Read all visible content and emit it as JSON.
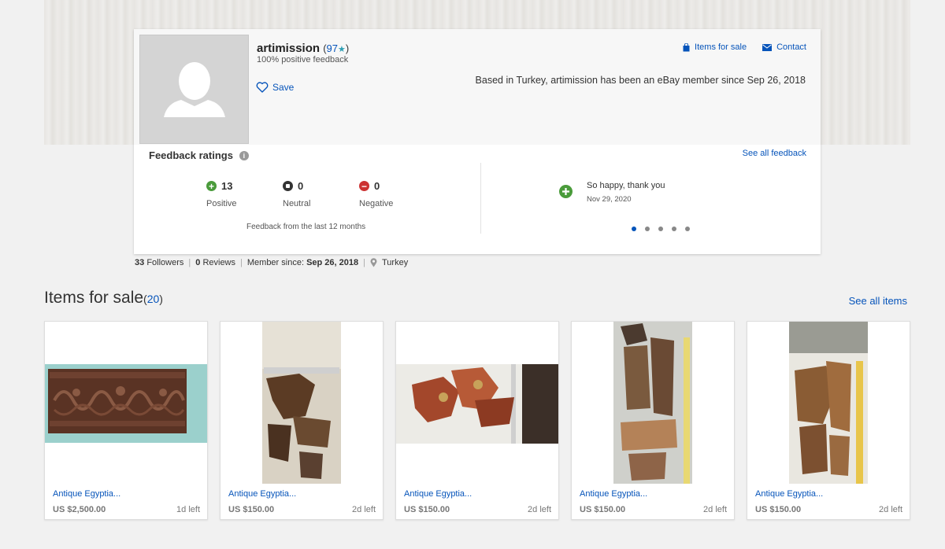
{
  "seller": {
    "username": "artimission",
    "score": "97",
    "positive_feedback": "100% positive feedback",
    "save_label": "Save",
    "based_text": "Based in Turkey, artimission has been an eBay member since Sep 26, 2018"
  },
  "top_links": {
    "items_for_sale": "Items for sale",
    "contact": "Contact"
  },
  "feedback": {
    "title": "Feedback ratings",
    "see_all": "See all feedback",
    "positive": {
      "count": "13",
      "label": "Positive"
    },
    "neutral": {
      "count": "0",
      "label": "Neutral"
    },
    "negative": {
      "count": "0",
      "label": "Negative"
    },
    "period": "Feedback from the last 12 months",
    "comment": "So happy, thank you",
    "comment_date": "Nov 29, 2020",
    "carousel_dots": 5,
    "carousel_active": 0
  },
  "stats": {
    "followers_count": "33",
    "followers_label": "Followers",
    "reviews_count": "0",
    "reviews_label": "Reviews",
    "member_since_label": "Member since:",
    "member_since": "Sep 26, 2018",
    "location": "Turkey"
  },
  "items_section": {
    "title": "Items for sale",
    "count": "20",
    "see_all": "See all items"
  },
  "items": [
    {
      "title": "Antique Egyptia...",
      "price": "US $2,500.00",
      "time_left": "1d left"
    },
    {
      "title": "Antique Egyptia...",
      "price": "US $150.00",
      "time_left": "2d left"
    },
    {
      "title": "Antique Egyptia...",
      "price": "US $150.00",
      "time_left": "2d left"
    },
    {
      "title": "Antique Egyptia...",
      "price": "US $150.00",
      "time_left": "2d left"
    },
    {
      "title": "Antique Egyptia...",
      "price": "US $150.00",
      "time_left": "2d left"
    }
  ],
  "colors": {
    "link": "#0654ba",
    "positive": "#4a9b3b",
    "negative": "#cc3333",
    "star": "#2f9fb4"
  }
}
